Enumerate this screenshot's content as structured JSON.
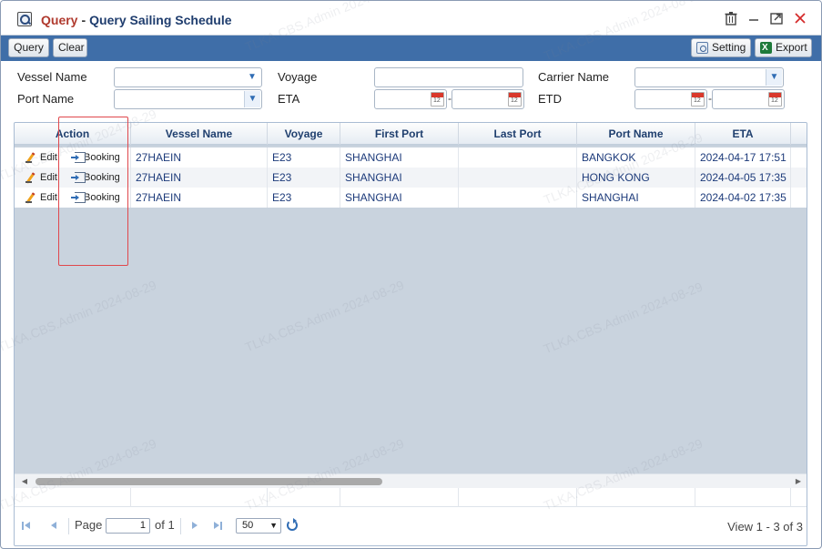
{
  "title": {
    "module": "Query",
    "separator": "-",
    "page": "Query Sailing Schedule"
  },
  "toolbar": {
    "query_label": "Query",
    "clear_label": "Clear",
    "setting_label": "Setting",
    "export_label": "Export"
  },
  "filters": {
    "vessel_name_label": "Vessel Name",
    "voyage_label": "Voyage",
    "carrier_name_label": "Carrier Name",
    "port_name_label": "Port Name",
    "eta_label": "ETA",
    "etd_label": "ETD",
    "vessel_name_value": "",
    "voyage_value": "",
    "carrier_name_value": "",
    "port_name_value": "",
    "eta_from": "",
    "eta_to": "",
    "etd_from": "",
    "etd_to": "",
    "range_separator": "-"
  },
  "grid": {
    "columns": [
      "Action",
      "Vessel Name",
      "Voyage",
      "First Port",
      "Last Port",
      "Port Name",
      "ETA"
    ],
    "action_edit": "Edit",
    "action_booking": "Booking",
    "rows": [
      {
        "vessel": "27HAEIN",
        "voyage": "E23",
        "first_port": "SHANGHAI",
        "last_port": "",
        "port_name": "BANGKOK",
        "eta": "2024-04-17 17:51"
      },
      {
        "vessel": "27HAEIN",
        "voyage": "E23",
        "first_port": "SHANGHAI",
        "last_port": "",
        "port_name": "HONG KONG",
        "eta": "2024-04-05 17:35"
      },
      {
        "vessel": "27HAEIN",
        "voyage": "E23",
        "first_port": "SHANGHAI",
        "last_port": "",
        "port_name": "SHANGHAI",
        "eta": "2024-04-02 17:35"
      }
    ]
  },
  "pager": {
    "page_label": "Page",
    "page_value": "1",
    "of_label": "of 1",
    "page_size": "50",
    "view_text": "View 1 - 3 of 3"
  },
  "watermark": "TLKA.CBS.Admin 2024-08-29",
  "colors": {
    "toolbar_bg": "#3f6ea8",
    "title_module": "#b03a2e",
    "title_page": "#1f3d6e",
    "highlight": "#e0474c"
  },
  "icons": {
    "title": "search-window-icon",
    "trash": "trash-icon",
    "minimize": "minimize-icon",
    "maximize": "maximize-icon",
    "close": "close-icon",
    "setting": "gear-icon",
    "export": "excel-icon",
    "edit": "pencil-icon",
    "booking": "login-icon",
    "refresh": "refresh-icon"
  }
}
